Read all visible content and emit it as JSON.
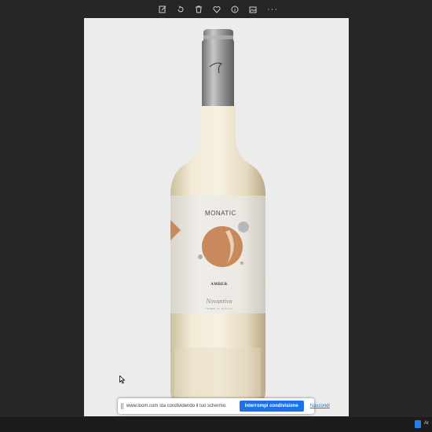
{
  "toolbar": {
    "buttons": [
      "edit-icon",
      "rotate-icon",
      "delete-icon",
      "favorite-icon",
      "info-icon",
      "edit-image-icon",
      "more-icon"
    ],
    "more_label": "···"
  },
  "photo": {
    "bottle": {
      "label": {
        "brand": "MONATIC",
        "wine_name": "AMBER",
        "producer": "Novantiva",
        "producer_subtitle": "TERRE DI SICILIA"
      },
      "colors": {
        "accent": "#c88a5d",
        "glass": "#efe7d4",
        "capsule": "#9c9c9c"
      }
    }
  },
  "share_bar": {
    "message": "www.loom.com sta condividendo il tuo schermo.",
    "stop_label": "Interrompi condivisione",
    "hide_label": "Nascondi"
  },
  "taskbar": {
    "tray_text": "Ar"
  }
}
